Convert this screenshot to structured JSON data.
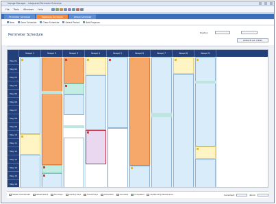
{
  "window": {
    "title": "Voyage Manager - Integrated Perimeter Schedule"
  },
  "menu": {
    "items": [
      "File",
      "Tools",
      "Windows",
      "Help"
    ]
  },
  "tabs": [
    {
      "label": "Perimeter Schedule"
    },
    {
      "label": "Trajectory Schedule"
    },
    {
      "label": "Vessel Schedule"
    }
  ],
  "toolbar": {
    "items": [
      {
        "label": "New"
      },
      {
        "label": "Save Schedule"
      },
      {
        "label": "Clear Schedule"
      },
      {
        "label": "Select Period"
      },
      {
        "label": "Add Program"
      }
    ]
  },
  "header": {
    "title": "Perimeter Schedule",
    "position_label": "Position",
    "position_value": "Jupiter 1",
    "view_label": "View",
    "view_value": "Day Week",
    "action_button": "UPDATE ALL ITEMS"
  },
  "grid": {
    "columns": [
      "Vessel 1",
      "Vessel 2",
      "Vessel 3",
      "Vessel 4",
      "Vessel 5",
      "Vessel 6",
      "Vessel 7",
      "Vessel 8",
      "Vessel 9"
    ],
    "rows": [
      "May 01",
      "May 02",
      "May 03",
      "May 04",
      "May 05",
      "May 06",
      "May 07",
      "May 08",
      "May 09",
      "May 10",
      "May 11",
      "May 12",
      "May 13",
      "May 14",
      "May 15",
      "May 16"
    ]
  },
  "legend": {
    "items": [
      {
        "label": "Vessel Unscheduled",
        "color": "#ffffff"
      },
      {
        "label": "Vessel Status",
        "color": "#d8ecfa"
      },
      {
        "label": "Port Days",
        "color": "#c3ece2"
      },
      {
        "label": "Loading Days",
        "color": "#fff5c4"
      },
      {
        "label": "Transit Days",
        "color": "#f6a86a"
      },
      {
        "label": "Scheduled",
        "color": "#e9d8f0"
      },
      {
        "label": "Cancelled",
        "color": "#f4c7c7"
      },
      {
        "label": "Completed",
        "color": "#9fd6a6"
      },
      {
        "label": "Outstanding Maintenance",
        "color": "#eeeeee"
      }
    ],
    "step_label": "Increment",
    "zoom_label": "Zoom"
  },
  "colors": {
    "nav": "#23407a",
    "tab_active": "#f58a3a",
    "blue_block": "#d8ecfa",
    "orange_block": "#f6a86a",
    "teal_block": "#c3ece2",
    "flag_red": "#d23a3a"
  }
}
